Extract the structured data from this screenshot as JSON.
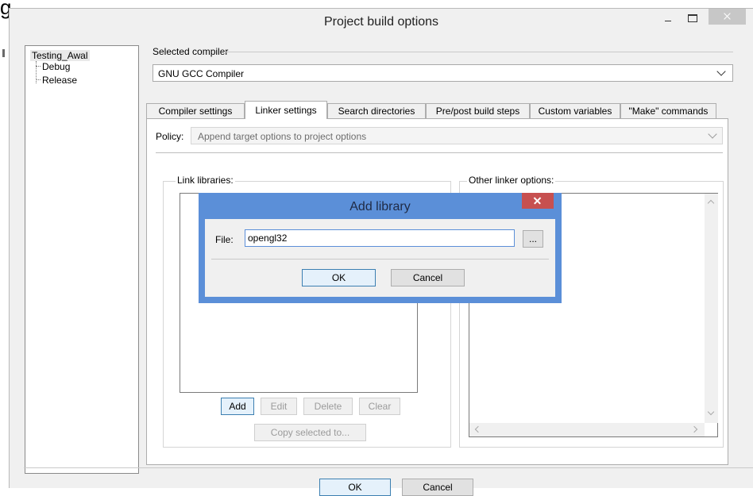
{
  "outer": {
    "caption": "g"
  },
  "window": {
    "title": "Project build options",
    "controls": {
      "minimize": "minimize-icon",
      "maximize": "maximize-icon",
      "close": "close-icon"
    }
  },
  "tree": {
    "root": "Testing_Awal",
    "children": [
      "Debug",
      "Release"
    ]
  },
  "compiler": {
    "label": "Selected compiler",
    "value": "GNU GCC Compiler"
  },
  "tabs": [
    {
      "label": "Compiler settings",
      "active": false
    },
    {
      "label": "Linker settings",
      "active": true
    },
    {
      "label": "Search directories",
      "active": false
    },
    {
      "label": "Pre/post build steps",
      "active": false
    },
    {
      "label": "Custom variables",
      "active": false
    },
    {
      "label": "\"Make\" commands",
      "active": false
    }
  ],
  "linker": {
    "policy_label": "Policy:",
    "policy_value": "Append target options to project options",
    "link_libraries_label": "Link libraries:",
    "other_options_label": "Other linker options:",
    "buttons": {
      "add": "Add",
      "edit": "Edit",
      "delete": "Delete",
      "clear": "Clear",
      "copy": "Copy selected to..."
    }
  },
  "dialog": {
    "title": "Add library",
    "file_label": "File:",
    "file_value": "opengl32",
    "browse": "...",
    "ok": "OK",
    "cancel": "Cancel"
  },
  "footer": {
    "ok": "OK",
    "cancel": "Cancel"
  },
  "colors": {
    "dialog_border": "#5b8fd8",
    "close_red": "#c75050",
    "window_bg": "#f0f0f0"
  }
}
